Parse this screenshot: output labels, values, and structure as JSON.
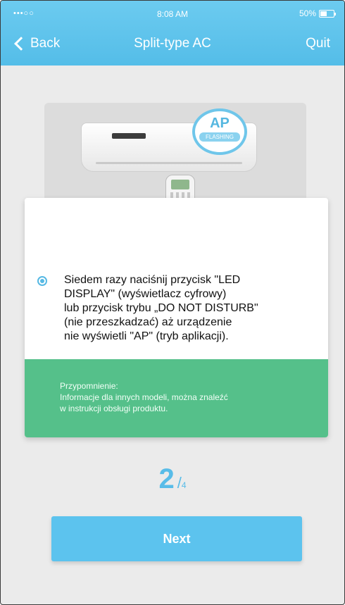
{
  "status_bar": {
    "signal": "•••○○",
    "time": "8:08 AM",
    "battery": "50%"
  },
  "nav": {
    "back_label": "Back",
    "title": "Split-type AC",
    "quit_label": "Quit"
  },
  "illustration": {
    "bubble_main": "AP",
    "bubble_sub": "FLASHING"
  },
  "card": {
    "instruction": "Siedem razy naciśnij przycisk \"LED\nDISPLAY\" (wyświetlacz cyfrowy)\nlub przycisk trybu „DO NOT DISTURB\"\n(nie przeszkadzać) aż urządzenie\nnie wyświetli \"AP\" (tryb aplikacji).",
    "reminder": "Przypomnienie:\nInformacje dla innych modeli, można znaleźć\nw instrukcji obsługi produktu."
  },
  "pager": {
    "current": "2",
    "separator": "/",
    "total": "4"
  },
  "next_label": "Next",
  "colors": {
    "header": "#5cc3ee",
    "accent": "#56b9e4",
    "reminder_bg": "#55c08a",
    "background": "#ebebeb"
  }
}
